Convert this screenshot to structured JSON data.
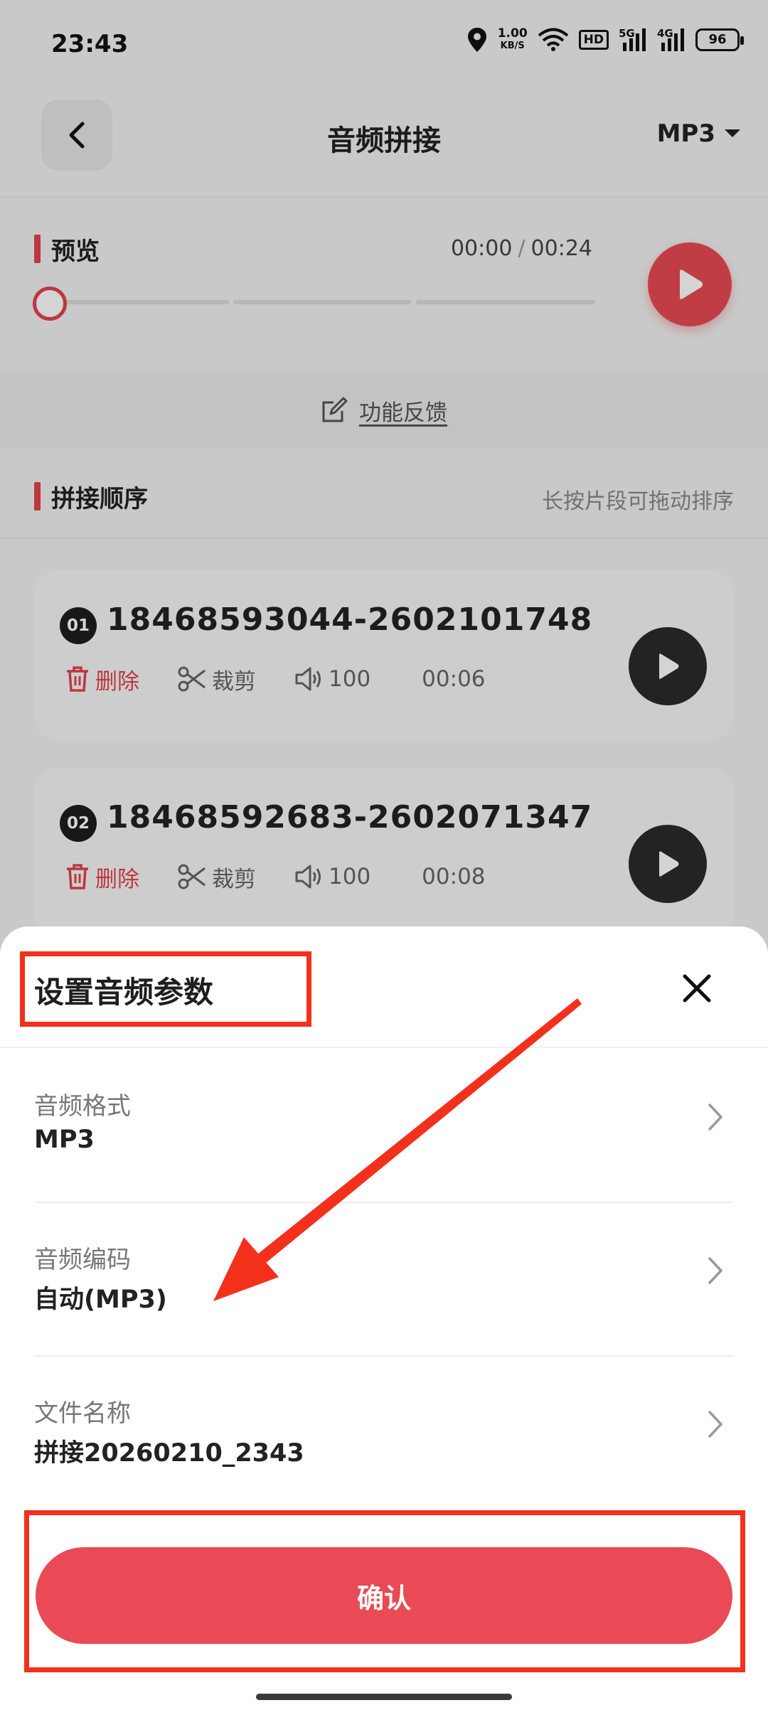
{
  "status_bar": {
    "time": "23:43",
    "net_speed_value": "1.00",
    "net_speed_unit": "KB/S",
    "hd_badge": "HD",
    "sim1_tag": "5G",
    "sim2_tag": "4G",
    "battery": "96"
  },
  "header": {
    "title": "音频拼接",
    "format": "MP3"
  },
  "preview": {
    "title": "预览",
    "current_time": "00:00",
    "total_time": "00:24",
    "progress": 0
  },
  "feedback": {
    "label": "功能反馈"
  },
  "sequence": {
    "title": "拼接顺序",
    "hint": "长按片段可拖动排序"
  },
  "clips": [
    {
      "index": "01",
      "name": "18468593044-2602101748",
      "delete_label": "删除",
      "cut_label": "裁剪",
      "volume": "100",
      "duration": "00:06"
    },
    {
      "index": "02",
      "name": "18468592683-2602071347",
      "delete_label": "删除",
      "cut_label": "裁剪",
      "volume": "100",
      "duration": "00:08"
    }
  ],
  "sheet": {
    "title": "设置音频参数",
    "options": [
      {
        "label": "音频格式",
        "value": "MP3"
      },
      {
        "label": "音频编码",
        "value": "自动(MP3)"
      },
      {
        "label": "文件名称",
        "value": "拼接20260210_2343"
      }
    ],
    "confirm_label": "确认"
  },
  "colors": {
    "accent": "#e94a55",
    "annotation": "#f2301c"
  }
}
